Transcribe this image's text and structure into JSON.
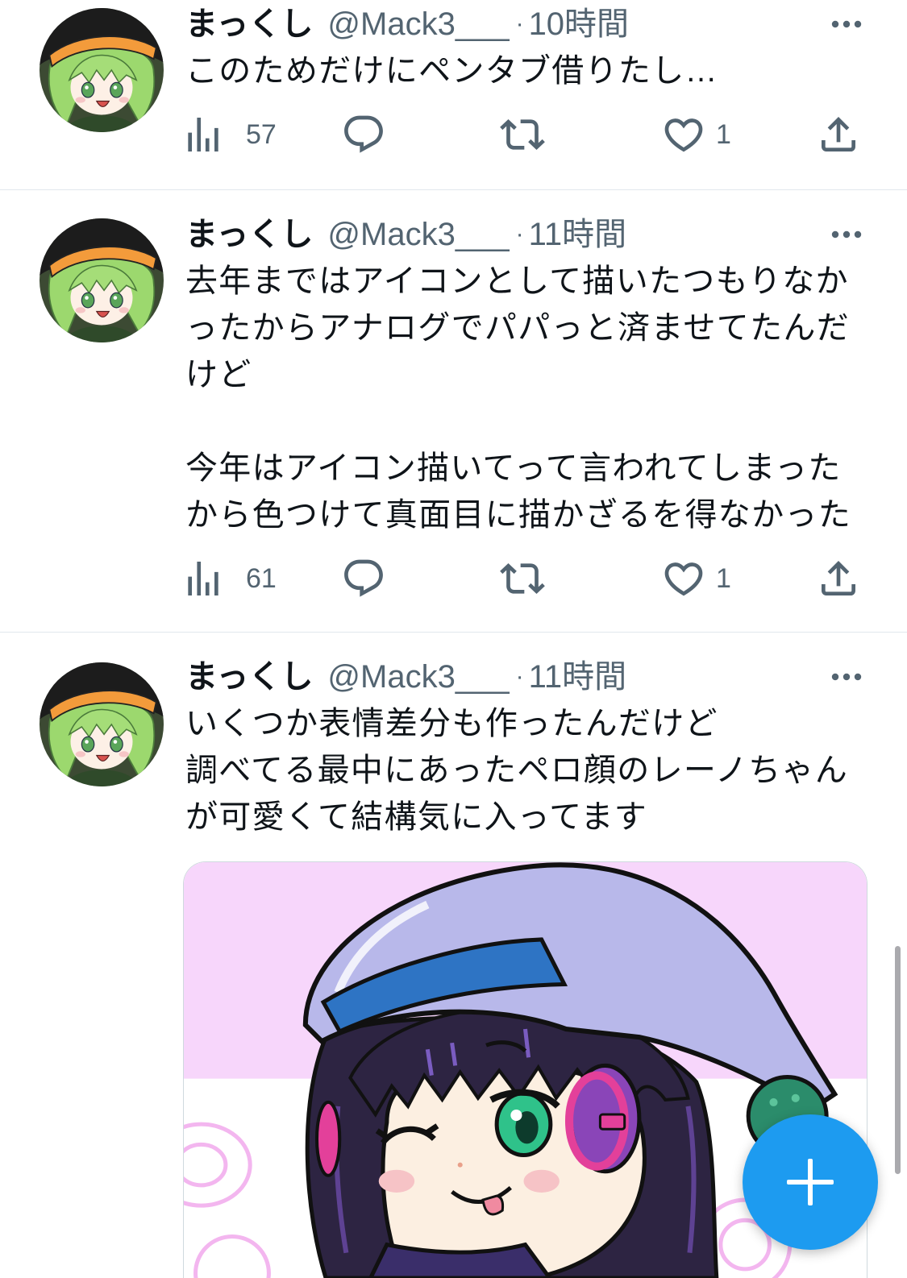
{
  "theme": {
    "accent_color": "#1D9BF0",
    "text_color": "#0F1419",
    "secondary_text_color": "#536471",
    "divider_color": "#E1E8ED"
  },
  "icons": {
    "views": "bar-chart-icon",
    "reply": "reply-icon",
    "retweet": "retweet-icon",
    "like": "heart-icon",
    "share": "share-icon",
    "more": "more-dots-icon",
    "compose": "plus-icon"
  },
  "tweets": [
    {
      "name": "まっくし",
      "handle": "@Mack3___",
      "separator": "·",
      "time": "10時間",
      "paragraphs": [
        [
          "このためだけにペンタブ借りたし…"
        ]
      ],
      "metrics": {
        "views": "57",
        "likes": "1"
      }
    },
    {
      "name": "まっくし",
      "handle": "@Mack3___",
      "separator": "·",
      "time": "11時間",
      "paragraphs": [
        [
          "去年まではアイコンとして描いたつもりなか",
          "ったからアナログでパパっと済ませてたんだ",
          "けど"
        ],
        [
          "今年はアイコン描いてって言われてしまった",
          "から色つけて真面目に描かざるを得なかった"
        ]
      ],
      "metrics": {
        "views": "61",
        "likes": "1"
      }
    },
    {
      "name": "まっくし",
      "handle": "@Mack3___",
      "separator": "·",
      "time": "11時間",
      "paragraphs": [
        [
          "いくつか表情差分も作ったんだけど",
          "調べてる最中にあったペロ顔のレーノちゃん",
          "が可愛くて結構気に入ってます"
        ]
      ],
      "media": {
        "type": "image"
      }
    }
  ],
  "fab": {
    "icon": "plus-icon",
    "color": "#1D9BF0"
  }
}
